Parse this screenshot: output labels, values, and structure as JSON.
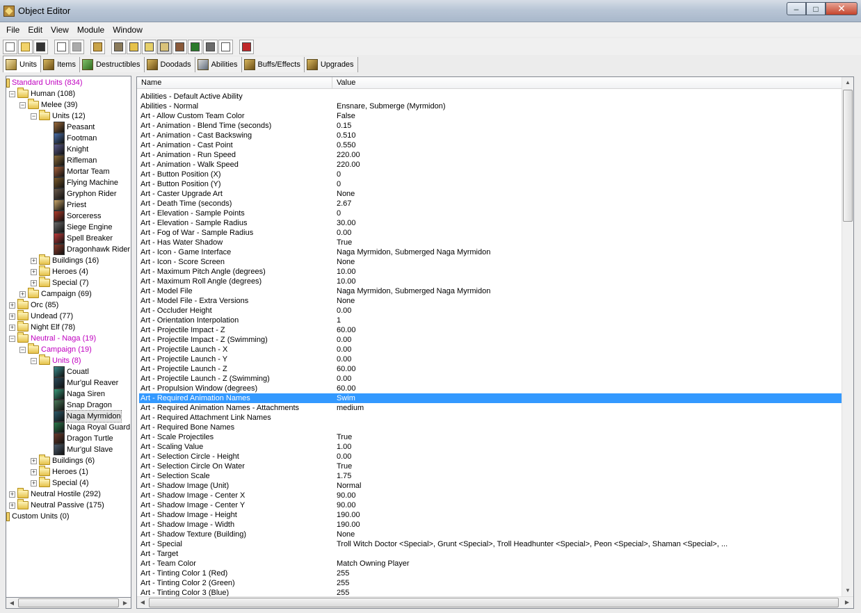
{
  "window": {
    "title": "Object Editor",
    "minimize": "–",
    "maximize": "□",
    "close": "✕"
  },
  "menu": [
    "File",
    "Edit",
    "View",
    "Module",
    "Window"
  ],
  "tabs": [
    {
      "label": "Units",
      "active": true
    },
    {
      "label": "Items"
    },
    {
      "label": "Destructibles"
    },
    {
      "label": "Doodads"
    },
    {
      "label": "Abilities"
    },
    {
      "label": "Buffs/Effects"
    },
    {
      "label": "Upgrades"
    }
  ],
  "tree": [
    {
      "label": "Standard Units (834)",
      "depth": 0,
      "magenta": true,
      "kind": "unitroot"
    },
    {
      "label": "Human (108)",
      "depth": 1,
      "exp": "-",
      "kind": "folder"
    },
    {
      "label": "Melee (39)",
      "depth": 2,
      "exp": "-",
      "kind": "folder"
    },
    {
      "label": "Units (12)",
      "depth": 3,
      "exp": "-",
      "kind": "folder"
    },
    {
      "label": "Peasant",
      "depth": 4,
      "kind": "unit",
      "color": "#9b6a3a"
    },
    {
      "label": "Footman",
      "depth": 4,
      "kind": "unit",
      "color": "#4a6ea8"
    },
    {
      "label": "Knight",
      "depth": 4,
      "kind": "unit",
      "color": "#5a5a8a"
    },
    {
      "label": "Rifleman",
      "depth": 4,
      "kind": "unit",
      "color": "#8a6a3a"
    },
    {
      "label": "Mortar Team",
      "depth": 4,
      "kind": "unit",
      "color": "#a5603a"
    },
    {
      "label": "Flying Machine",
      "depth": 4,
      "kind": "unit",
      "color": "#7a5a2a"
    },
    {
      "label": "Gryphon Rider",
      "depth": 4,
      "kind": "unit",
      "color": "#6a5a4a"
    },
    {
      "label": "Priest",
      "depth": 4,
      "kind": "unit",
      "color": "#c9a66a"
    },
    {
      "label": "Sorceress",
      "depth": 4,
      "kind": "unit",
      "color": "#b03a2a"
    },
    {
      "label": "Siege Engine",
      "depth": 4,
      "kind": "unit",
      "color": "#6a6a6a"
    },
    {
      "label": "Spell Breaker",
      "depth": 4,
      "kind": "unit",
      "color": "#c03a3a"
    },
    {
      "label": "Dragonhawk Rider",
      "depth": 4,
      "kind": "unit",
      "color": "#8a3a2a"
    },
    {
      "label": "Buildings (16)",
      "depth": 3,
      "exp": "+",
      "kind": "folder"
    },
    {
      "label": "Heroes (4)",
      "depth": 3,
      "exp": "+",
      "kind": "folder"
    },
    {
      "label": "Special (7)",
      "depth": 3,
      "exp": "+",
      "kind": "folder"
    },
    {
      "label": "Campaign (69)",
      "depth": 2,
      "exp": "+",
      "kind": "folder"
    },
    {
      "label": "Orc (85)",
      "depth": 1,
      "exp": "+",
      "kind": "folder"
    },
    {
      "label": "Undead (77)",
      "depth": 1,
      "exp": "+",
      "kind": "folder"
    },
    {
      "label": "Night Elf (78)",
      "depth": 1,
      "exp": "+",
      "kind": "folder"
    },
    {
      "label": "Neutral - Naga (19)",
      "depth": 1,
      "exp": "-",
      "kind": "folder",
      "magenta": true
    },
    {
      "label": "Campaign (19)",
      "depth": 2,
      "exp": "-",
      "kind": "folder",
      "magenta": true
    },
    {
      "label": "Units (8)",
      "depth": 3,
      "exp": "-",
      "kind": "folder",
      "magenta": true
    },
    {
      "label": "Couatl",
      "depth": 4,
      "kind": "unit",
      "color": "#3a8a8a"
    },
    {
      "label": "Mur'gul Reaver",
      "depth": 4,
      "kind": "unit",
      "color": "#2a4a5a"
    },
    {
      "label": "Naga Siren",
      "depth": 4,
      "kind": "unit",
      "color": "#3a9a7a"
    },
    {
      "label": "Snap Dragon",
      "depth": 4,
      "kind": "unit",
      "color": "#4a7a5a"
    },
    {
      "label": "Naga Myrmidon",
      "depth": 4,
      "kind": "unit",
      "color": "#2a5a6a",
      "selected": true
    },
    {
      "label": "Naga Royal Guard",
      "depth": 4,
      "kind": "unit",
      "color": "#2a7a4a"
    },
    {
      "label": "Dragon Turtle",
      "depth": 4,
      "kind": "unit",
      "color": "#6a3a2a"
    },
    {
      "label": "Mur'gul Slave",
      "depth": 4,
      "kind": "unit",
      "color": "#4a5a6a"
    },
    {
      "label": "Buildings (6)",
      "depth": 3,
      "exp": "+",
      "kind": "folder"
    },
    {
      "label": "Heroes (1)",
      "depth": 3,
      "exp": "+",
      "kind": "folder"
    },
    {
      "label": "Special (4)",
      "depth": 3,
      "exp": "+",
      "kind": "folder"
    },
    {
      "label": "Neutral Hostile (292)",
      "depth": 1,
      "exp": "+",
      "kind": "folder"
    },
    {
      "label": "Neutral Passive (175)",
      "depth": 1,
      "exp": "+",
      "kind": "folder"
    },
    {
      "label": "Custom Units (0)",
      "depth": 0,
      "kind": "unitroot"
    }
  ],
  "grid": {
    "columns": [
      "Name",
      "Value"
    ],
    "rows": [
      [
        "Abilities - Default Active Ability",
        ""
      ],
      [
        "Abilities - Normal",
        "Ensnare, Submerge (Myrmidon)"
      ],
      [
        "Art - Allow Custom Team Color",
        "False"
      ],
      [
        "Art - Animation - Blend Time (seconds)",
        "0.15"
      ],
      [
        "Art - Animation - Cast Backswing",
        "0.510"
      ],
      [
        "Art - Animation - Cast Point",
        "0.550"
      ],
      [
        "Art - Animation - Run Speed",
        "220.00"
      ],
      [
        "Art - Animation - Walk Speed",
        "220.00"
      ],
      [
        "Art - Button Position (X)",
        "0"
      ],
      [
        "Art - Button Position (Y)",
        "0"
      ],
      [
        "Art - Caster Upgrade Art",
        "None"
      ],
      [
        "Art - Death Time (seconds)",
        "2.67"
      ],
      [
        "Art - Elevation - Sample Points",
        "0"
      ],
      [
        "Art - Elevation - Sample Radius",
        "30.00"
      ],
      [
        "Art - Fog of War - Sample Radius",
        "0.00"
      ],
      [
        "Art - Has Water Shadow",
        "True"
      ],
      [
        "Art - Icon - Game Interface",
        "Naga Myrmidon, Submerged Naga Myrmidon"
      ],
      [
        "Art - Icon - Score Screen",
        "None"
      ],
      [
        "Art - Maximum Pitch Angle (degrees)",
        "10.00"
      ],
      [
        "Art - Maximum Roll Angle (degrees)",
        "10.00"
      ],
      [
        "Art - Model File",
        "Naga Myrmidon, Submerged Naga Myrmidon"
      ],
      [
        "Art - Model File - Extra Versions",
        "None"
      ],
      [
        "Art - Occluder Height",
        "0.00"
      ],
      [
        "Art - Orientation Interpolation",
        "1"
      ],
      [
        "Art - Projectile Impact - Z",
        "60.00"
      ],
      [
        "Art - Projectile Impact - Z (Swimming)",
        "0.00"
      ],
      [
        "Art - Projectile Launch - X",
        "0.00"
      ],
      [
        "Art - Projectile Launch - Y",
        "0.00"
      ],
      [
        "Art - Projectile Launch - Z",
        "60.00"
      ],
      [
        "Art - Projectile Launch - Z (Swimming)",
        "0.00"
      ],
      [
        "Art - Propulsion Window (degrees)",
        "60.00"
      ],
      [
        "Art - Required Animation Names",
        "Swim"
      ],
      [
        "Art - Required Animation Names - Attachments",
        "medium"
      ],
      [
        "Art - Required Attachment Link Names",
        ""
      ],
      [
        "Art - Required Bone Names",
        ""
      ],
      [
        "Art - Scale Projectiles",
        "True"
      ],
      [
        "Art - Scaling Value",
        "1.00"
      ],
      [
        "Art - Selection Circle - Height",
        "0.00"
      ],
      [
        "Art - Selection Circle On Water",
        "True"
      ],
      [
        "Art - Selection Scale",
        "1.75"
      ],
      [
        "Art - Shadow Image (Unit)",
        "Normal"
      ],
      [
        "Art - Shadow Image - Center X",
        "90.00"
      ],
      [
        "Art - Shadow Image - Center Y",
        "90.00"
      ],
      [
        "Art - Shadow Image - Height",
        "190.00"
      ],
      [
        "Art - Shadow Image - Width",
        "190.00"
      ],
      [
        "Art - Shadow Texture (Building)",
        "None"
      ],
      [
        "Art - Special",
        "Troll Witch Doctor <Special>, Grunt <Special>, Troll Headhunter <Special>, Peon <Special>, Shaman <Special>, ..."
      ],
      [
        "Art - Target",
        ""
      ],
      [
        "Art - Team Color",
        "Match Owning Player"
      ],
      [
        "Art - Tinting Color 1 (Red)",
        "255"
      ],
      [
        "Art - Tinting Color 2 (Green)",
        "255"
      ],
      [
        "Art - Tinting Color 3 (Blue)",
        "255"
      ]
    ],
    "selected_row": 31
  },
  "colors": {
    "selection": "#3399ff",
    "highlight": "#c000c0"
  }
}
